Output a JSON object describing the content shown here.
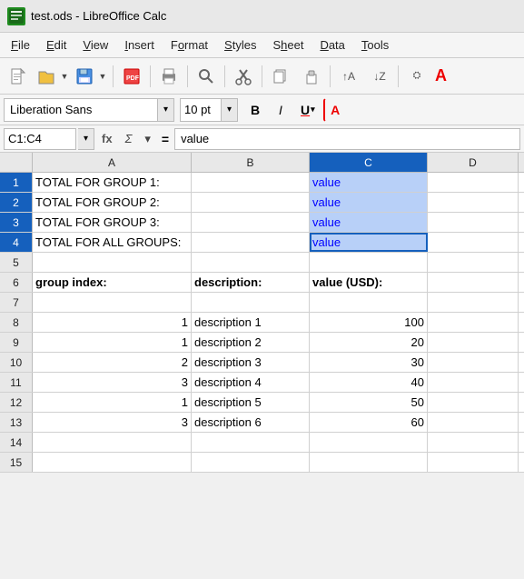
{
  "titleBar": {
    "icon": "▦",
    "title": "test.ods - LibreOffice Calc"
  },
  "menuBar": {
    "items": [
      {
        "label": "File",
        "underline": "F"
      },
      {
        "label": "Edit",
        "underline": "E"
      },
      {
        "label": "View",
        "underline": "V"
      },
      {
        "label": "Insert",
        "underline": "I"
      },
      {
        "label": "Format",
        "underline": "o"
      },
      {
        "label": "Styles",
        "underline": "S"
      },
      {
        "label": "Sheet",
        "underline": "h"
      },
      {
        "label": "Data",
        "underline": "D"
      },
      {
        "label": "Tools",
        "underline": "T"
      }
    ]
  },
  "formatBar": {
    "fontName": "Liberation Sans",
    "fontSize": "10 pt",
    "boldLabel": "B",
    "italicLabel": "I",
    "underlineLabel": "U"
  },
  "formulaBar": {
    "cellRef": "C1:C4",
    "funcLabel": "fx",
    "sumLabel": "Σ",
    "arrowLabel": "▾",
    "equalsLabel": "=",
    "formula": "value"
  },
  "columns": {
    "headers": [
      "",
      "A",
      "B",
      "C",
      "D"
    ],
    "selectedCol": "C"
  },
  "rows": [
    {
      "num": "1",
      "selected": true,
      "cells": [
        {
          "col": "a",
          "value": "TOTAL FOR GROUP 1:",
          "align": "left",
          "bold": false
        },
        {
          "col": "b",
          "value": "",
          "align": "left"
        },
        {
          "col": "c",
          "value": "value",
          "align": "left",
          "selected": true,
          "color": "blue"
        },
        {
          "col": "d",
          "value": "",
          "align": "left"
        }
      ]
    },
    {
      "num": "2",
      "selected": true,
      "cells": [
        {
          "col": "a",
          "value": "TOTAL FOR GROUP 2:",
          "align": "left"
        },
        {
          "col": "b",
          "value": "",
          "align": "left"
        },
        {
          "col": "c",
          "value": "value",
          "align": "left",
          "selected": true,
          "color": "blue"
        },
        {
          "col": "d",
          "value": "",
          "align": "left"
        }
      ]
    },
    {
      "num": "3",
      "selected": true,
      "cells": [
        {
          "col": "a",
          "value": "TOTAL FOR GROUP 3:",
          "align": "left"
        },
        {
          "col": "b",
          "value": "",
          "align": "left"
        },
        {
          "col": "c",
          "value": "value",
          "align": "left",
          "selected": true,
          "color": "blue"
        },
        {
          "col": "d",
          "value": "",
          "align": "left"
        }
      ]
    },
    {
      "num": "4",
      "selected": true,
      "cells": [
        {
          "col": "a",
          "value": "TOTAL FOR ALL GROUPS:",
          "align": "left"
        },
        {
          "col": "b",
          "value": "",
          "align": "left"
        },
        {
          "col": "c",
          "value": "value",
          "align": "left",
          "selected": true,
          "active": true,
          "color": "blue"
        },
        {
          "col": "d",
          "value": "",
          "align": "left"
        }
      ]
    },
    {
      "num": "5",
      "cells": [
        {
          "col": "a",
          "value": ""
        },
        {
          "col": "b",
          "value": ""
        },
        {
          "col": "c",
          "value": ""
        },
        {
          "col": "d",
          "value": ""
        }
      ]
    },
    {
      "num": "6",
      "cells": [
        {
          "col": "a",
          "value": "group index:",
          "align": "left",
          "bold": true
        },
        {
          "col": "b",
          "value": "description:",
          "align": "left",
          "bold": true
        },
        {
          "col": "c",
          "value": "value (USD):",
          "align": "left",
          "bold": true
        },
        {
          "col": "d",
          "value": ""
        }
      ]
    },
    {
      "num": "7",
      "cells": [
        {
          "col": "a",
          "value": ""
        },
        {
          "col": "b",
          "value": ""
        },
        {
          "col": "c",
          "value": ""
        },
        {
          "col": "d",
          "value": ""
        }
      ]
    },
    {
      "num": "8",
      "cells": [
        {
          "col": "a",
          "value": "1",
          "align": "right"
        },
        {
          "col": "b",
          "value": "description 1",
          "align": "left"
        },
        {
          "col": "c",
          "value": "100",
          "align": "right"
        },
        {
          "col": "d",
          "value": ""
        }
      ]
    },
    {
      "num": "9",
      "cells": [
        {
          "col": "a",
          "value": "1",
          "align": "right"
        },
        {
          "col": "b",
          "value": "description 2",
          "align": "left"
        },
        {
          "col": "c",
          "value": "20",
          "align": "right"
        },
        {
          "col": "d",
          "value": ""
        }
      ]
    },
    {
      "num": "10",
      "cells": [
        {
          "col": "a",
          "value": "2",
          "align": "right"
        },
        {
          "col": "b",
          "value": "description 3",
          "align": "left"
        },
        {
          "col": "c",
          "value": "30",
          "align": "right"
        },
        {
          "col": "d",
          "value": ""
        }
      ]
    },
    {
      "num": "11",
      "cells": [
        {
          "col": "a",
          "value": "3",
          "align": "right"
        },
        {
          "col": "b",
          "value": "description 4",
          "align": "left"
        },
        {
          "col": "c",
          "value": "40",
          "align": "right"
        },
        {
          "col": "d",
          "value": ""
        }
      ]
    },
    {
      "num": "12",
      "cells": [
        {
          "col": "a",
          "value": "1",
          "align": "right"
        },
        {
          "col": "b",
          "value": "description 5",
          "align": "left"
        },
        {
          "col": "c",
          "value": "50",
          "align": "right"
        },
        {
          "col": "d",
          "value": ""
        }
      ]
    },
    {
      "num": "13",
      "cells": [
        {
          "col": "a",
          "value": "3",
          "align": "right"
        },
        {
          "col": "b",
          "value": "description 6",
          "align": "left"
        },
        {
          "col": "c",
          "value": "60",
          "align": "right"
        },
        {
          "col": "d",
          "value": ""
        }
      ]
    },
    {
      "num": "14",
      "cells": [
        {
          "col": "a",
          "value": ""
        },
        {
          "col": "b",
          "value": ""
        },
        {
          "col": "c",
          "value": ""
        },
        {
          "col": "d",
          "value": ""
        }
      ]
    },
    {
      "num": "15",
      "cells": [
        {
          "col": "a",
          "value": ""
        },
        {
          "col": "b",
          "value": ""
        },
        {
          "col": "c",
          "value": ""
        },
        {
          "col": "d",
          "value": ""
        }
      ]
    }
  ]
}
